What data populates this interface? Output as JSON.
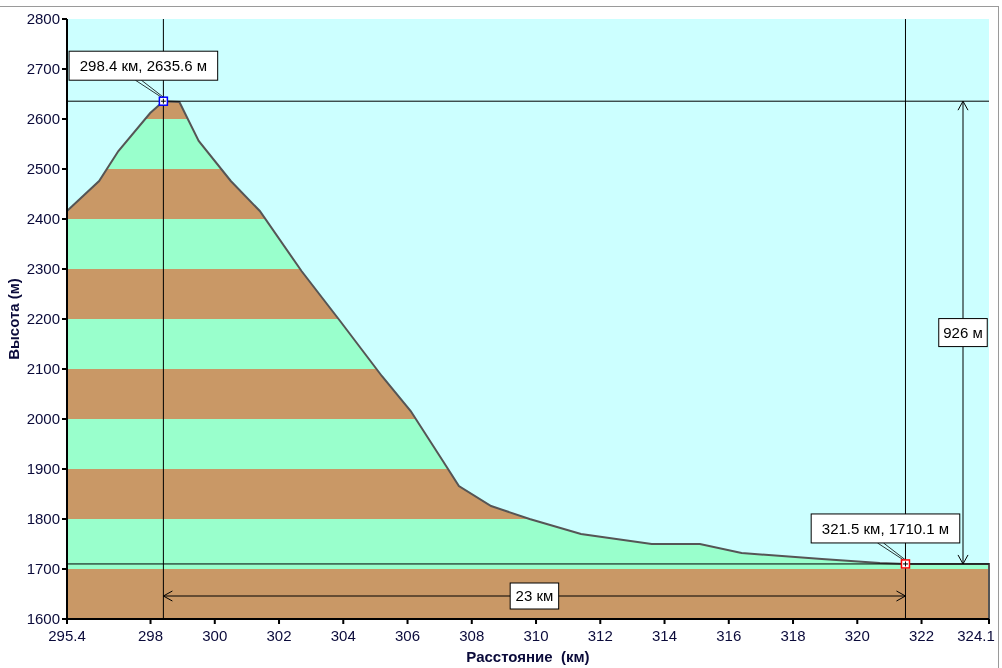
{
  "chart_data": {
    "type": "area",
    "xlabel": "Расстояние  (км)",
    "ylabel": "Высота (м)",
    "x": [
      295.4,
      296.4,
      297.0,
      297.99,
      298.4,
      298.9,
      299.5,
      300.5,
      301.4,
      302.7,
      303.9,
      305.2,
      306.1,
      307.1,
      307.6,
      308.6,
      309.8,
      311.4,
      313.6,
      315.1,
      316.4,
      318.9,
      320.7,
      321.5,
      324.1
    ],
    "series": [
      {
        "color": "#555555",
        "values": [
          2416,
          2476,
          2536,
          2612,
          2635.6,
          2634,
          2556,
          2476,
          2416,
          2296,
          2196,
          2086,
          2016,
          1916,
          1866,
          1826,
          1800,
          1770,
          1750,
          1750,
          1732,
          1720,
          1712,
          1710.1,
          1710
        ]
      }
    ],
    "xlim": [
      295.4,
      324.1
    ],
    "ylim": [
      1600,
      2800
    ],
    "xticks": [
      295.4,
      298,
      300,
      302,
      304,
      306,
      308,
      310,
      312,
      314,
      316,
      318,
      320,
      322,
      324.1
    ],
    "yticks": [
      1600,
      1700,
      1800,
      1900,
      2000,
      2100,
      2200,
      2300,
      2400,
      2500,
      2600,
      2700,
      2800
    ],
    "annotations": [
      {
        "x": 298.4,
        "y": 2635.6,
        "text": "298.4 км, 2635.6 м"
      },
      {
        "x": 321.5,
        "y": 1710.1,
        "text": "321.5 км, 1710.1 м"
      },
      "23 км",
      "926 м"
    ]
  }
}
